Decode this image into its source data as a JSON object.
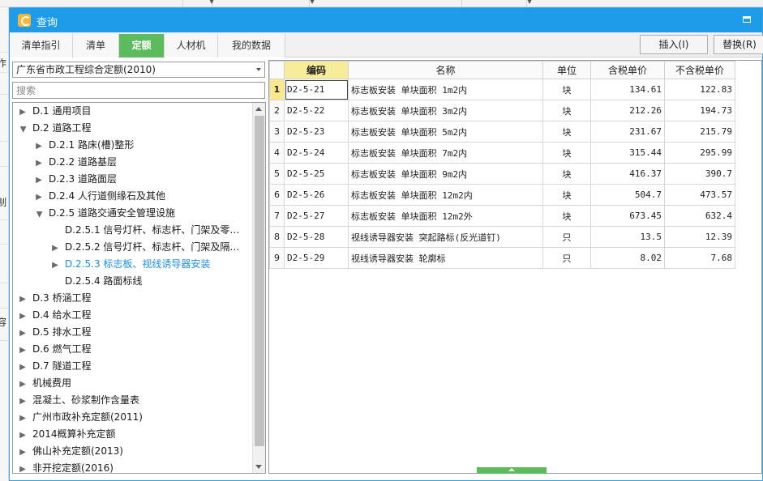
{
  "bg": {
    "left_hints": [
      "作",
      "制",
      "容"
    ]
  },
  "dialog": {
    "title": "查询"
  },
  "tabs": [
    {
      "label": "清单指引"
    },
    {
      "label": "清单"
    },
    {
      "label": "定额"
    },
    {
      "label": "人材机"
    },
    {
      "label": "我的数据"
    }
  ],
  "buttons": {
    "insert": "插入(I)",
    "replace": "替换(R)"
  },
  "left": {
    "combo_value": "广东省市政工程综合定额(2010)",
    "search_placeholder": "搜索",
    "tree": [
      {
        "label": "D.1 通用项目",
        "state": "collapsed"
      },
      {
        "label": "D.2 道路工程",
        "state": "expanded"
      },
      {
        "label": "D.2.1 路床(槽)整形",
        "state": "collapsed"
      },
      {
        "label": "D.2.2 道路基层",
        "state": "collapsed"
      },
      {
        "label": "D.2.3 道路面层",
        "state": "collapsed"
      },
      {
        "label": "D.2.4 人行道侧缘石及其他",
        "state": "collapsed"
      },
      {
        "label": "D.2.5 道路交通安全管理设施",
        "state": "expanded"
      },
      {
        "label": "D.2.5.1 信号灯杆、标志杆、门架及零…",
        "state": "leaf"
      },
      {
        "label": "D.2.5.2 信号灯杆、标志杆、门架及隔…",
        "state": "collapsed"
      },
      {
        "label": "D.2.5.3 标志板、视线诱导器安装",
        "state": "collapsed",
        "selected": true
      },
      {
        "label": "D.2.5.4 路面标线",
        "state": "leaf"
      },
      {
        "label": "D.3 桥涵工程",
        "state": "collapsed"
      },
      {
        "label": "D.4 给水工程",
        "state": "collapsed"
      },
      {
        "label": "D.5 排水工程",
        "state": "collapsed"
      },
      {
        "label": "D.6 燃气工程",
        "state": "collapsed"
      },
      {
        "label": "D.7 隧道工程",
        "state": "collapsed"
      },
      {
        "label": "机械费用",
        "state": "collapsed"
      },
      {
        "label": "混凝土、砂浆制作含量表",
        "state": "collapsed"
      },
      {
        "label": "广州市政补充定额(2011)",
        "state": "collapsed"
      },
      {
        "label": "2014概算补充定额",
        "state": "collapsed"
      },
      {
        "label": "佛山补充定额(2013)",
        "state": "collapsed"
      },
      {
        "label": "非开挖定额(2016)",
        "state": "collapsed"
      }
    ]
  },
  "grid": {
    "columns": {
      "code": "编码",
      "name": "名称",
      "unit": "单位",
      "tax_price": "含税单价",
      "notax_price": "不含税单价"
    },
    "rows": [
      {
        "idx": "1",
        "code": "D2-5-21",
        "name": "标志板安装 单块面积 1m2内",
        "unit": "块",
        "tax_price": "134.61",
        "notax_price": "122.83"
      },
      {
        "idx": "2",
        "code": "D2-5-22",
        "name": "标志板安装 单块面积 3m2内",
        "unit": "块",
        "tax_price": "212.26",
        "notax_price": "194.73"
      },
      {
        "idx": "3",
        "code": "D2-5-23",
        "name": "标志板安装 单块面积 5m2内",
        "unit": "块",
        "tax_price": "231.67",
        "notax_price": "215.79"
      },
      {
        "idx": "4",
        "code": "D2-5-24",
        "name": "标志板安装 单块面积 7m2内",
        "unit": "块",
        "tax_price": "315.44",
        "notax_price": "295.99"
      },
      {
        "idx": "5",
        "code": "D2-5-25",
        "name": "标志板安装 单块面积 9m2内",
        "unit": "块",
        "tax_price": "416.37",
        "notax_price": "390.7"
      },
      {
        "idx": "6",
        "code": "D2-5-26",
        "name": "标志板安装 单块面积 12m2内",
        "unit": "块",
        "tax_price": "504.7",
        "notax_price": "473.57"
      },
      {
        "idx": "7",
        "code": "D2-5-27",
        "name": "标志板安装 单块面积 12m2外",
        "unit": "块",
        "tax_price": "673.45",
        "notax_price": "632.4"
      },
      {
        "idx": "8",
        "code": "D2-5-28",
        "name": "视线诱导器安装 突起路标(反光道钉)",
        "unit": "只",
        "tax_price": "13.5",
        "notax_price": "12.39"
      },
      {
        "idx": "9",
        "code": "D2-5-29",
        "name": "视线诱导器安装 轮廓标",
        "unit": "只",
        "tax_price": "8.02",
        "notax_price": "7.68"
      }
    ]
  }
}
